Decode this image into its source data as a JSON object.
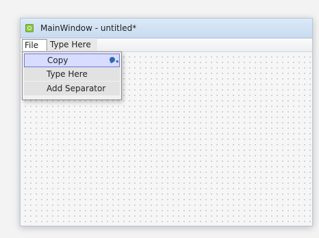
{
  "window": {
    "title": "MainWindow - untitled*"
  },
  "menubar": {
    "items": [
      {
        "label": "File"
      },
      {
        "label": "Type Here"
      }
    ]
  },
  "file_menu": {
    "items": [
      {
        "label": "Copy"
      },
      {
        "label": "Type Here"
      },
      {
        "label": "Add Separator"
      }
    ]
  },
  "icons": {
    "app": "qt-app-icon",
    "copy_shortcut": "cursor-hint-icon"
  },
  "colors": {
    "titlebar": "#c8dbef",
    "selection_fill": "#d8dcff",
    "selection_border": "#6f73d8",
    "app_icon": "#8ec642"
  }
}
